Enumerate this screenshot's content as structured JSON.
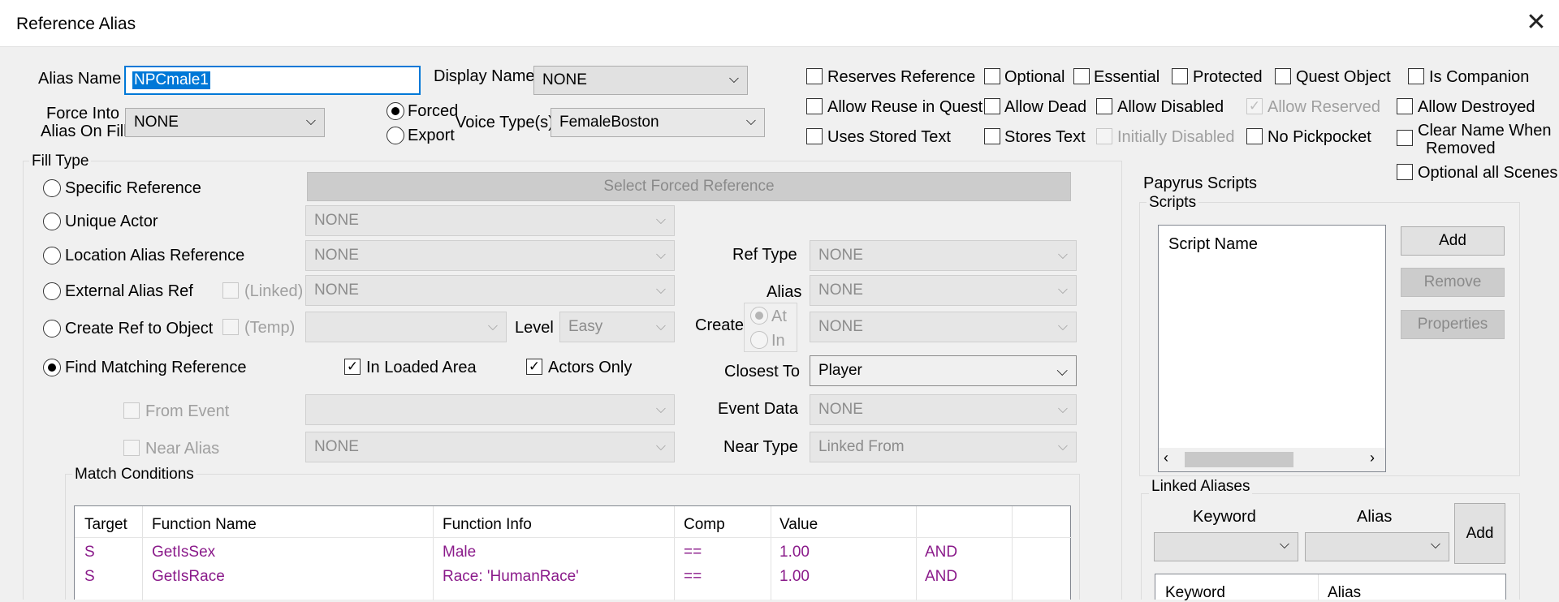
{
  "window": {
    "title": "Reference Alias",
    "close_glyph": "✕"
  },
  "alias_name": {
    "label": "Alias Name",
    "value": "NPCmale1"
  },
  "display_name": {
    "label": "Display Name",
    "value": "NONE"
  },
  "force_into": {
    "label_line1": "Force Into",
    "label_line2": "Alias On Fill",
    "value": "NONE"
  },
  "forced_radio": {
    "label": "Forced",
    "checked": true
  },
  "export_radio": {
    "label": "Export",
    "checked": false
  },
  "voice_type": {
    "label": "Voice Type(s)",
    "value": "FemaleBoston"
  },
  "flags": {
    "reserves_reference": "Reserves Reference",
    "optional": "Optional",
    "essential": "Essential",
    "protected": "Protected",
    "quest_object": "Quest Object",
    "is_companion": "Is Companion",
    "allow_reuse": "Allow Reuse in Quest",
    "allow_dead": "Allow Dead",
    "allow_disabled": "Allow Disabled",
    "allow_reserved": "Allow Reserved",
    "allow_destroyed": "Allow Destroyed",
    "uses_stored_text": "Uses Stored Text",
    "stores_text": "Stores Text",
    "initially_disabled": "Initially Disabled",
    "no_pickpocket": "No Pickpocket",
    "clear_name_line1": "Clear Name When",
    "clear_name_line2": "Removed",
    "optional_all_scenes": "Optional all Scenes"
  },
  "fill_type": {
    "title": "Fill Type",
    "specific_reference": "Specific Reference",
    "select_forced_reference": "Select Forced Reference",
    "unique_actor": "Unique Actor",
    "unique_actor_value": "NONE",
    "location_alias_reference": "Location Alias Reference",
    "location_alias_value": "NONE",
    "ref_type_label": "Ref Type",
    "ref_type_value": "NONE",
    "external_alias_ref": "External Alias Ref",
    "linked_label": "(Linked)",
    "external_alias_value": "NONE",
    "alias_label": "Alias",
    "alias_value": "NONE",
    "create_ref_to_object": "Create Ref to Object",
    "temp_label": "(Temp)",
    "create_ref_value": "",
    "level_label": "Level",
    "level_value": "Easy",
    "create_label": "Create",
    "create_at": "At",
    "create_in": "In",
    "create_value": "NONE",
    "find_matching_reference": "Find Matching Reference",
    "in_loaded_area": "In Loaded Area",
    "actors_only": "Actors Only",
    "closest_to_label": "Closest To",
    "closest_to_value": "Player",
    "from_event": "From Event",
    "from_event_value": "",
    "event_data_label": "Event Data",
    "event_data_value": "NONE",
    "near_alias": "Near Alias",
    "near_alias_value": "NONE",
    "near_type_label": "Near Type",
    "near_type_value": "Linked From"
  },
  "match_conditions": {
    "title": "Match Conditions",
    "columns": [
      "Target",
      "Function Name",
      "Function Info",
      "Comp",
      "Value",
      ""
    ],
    "rows": [
      [
        "S",
        "GetIsSex",
        "Male",
        "==",
        "1.00",
        "AND"
      ],
      [
        "S",
        "GetIsRace",
        "Race: 'HumanRace'",
        "==",
        "1.00",
        "AND"
      ]
    ]
  },
  "papyrus": {
    "title": "Papyrus Scripts",
    "scripts_group": "Scripts",
    "script_name_header": "Script Name",
    "add": "Add",
    "remove": "Remove",
    "properties": "Properties"
  },
  "linked_aliases": {
    "title": "Linked Aliases",
    "keyword_label": "Keyword",
    "alias_label": "Alias",
    "add": "Add",
    "columns": [
      "Keyword",
      "Alias"
    ]
  },
  "colors": {
    "selection": "#0078d7",
    "condition_text": "#8a1a8a"
  }
}
